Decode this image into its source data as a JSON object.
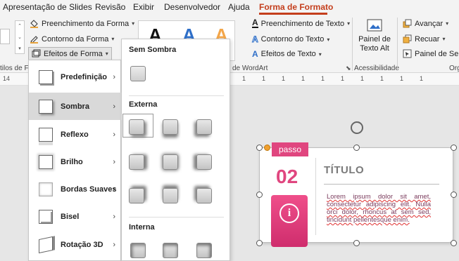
{
  "menubar": {
    "tabs": [
      {
        "label": "Apresentação de Slides"
      },
      {
        "label": "Revisão"
      },
      {
        "label": "Exibir"
      },
      {
        "label": "Desenvolvedor"
      },
      {
        "label": "Ajuda"
      },
      {
        "label": "Forma de Formato"
      }
    ]
  },
  "ribbon": {
    "fill_label": "Preenchimento da Forma",
    "outline_label": "Contorno da Forma",
    "effects_label": "Efeitos de Forma",
    "styles_group_label": "tilos de Fo",
    "wordart_group_label": "de WordArt",
    "text_fill_label": "Preenchimento de Texto",
    "text_outline_label": "Contorno do Texto",
    "text_effects_label": "Efeitos de Texto",
    "alt_text_line1": "Painel de",
    "alt_text_line2": "Texto Alt",
    "accessibility_group_label": "Acessibilidade",
    "forward_label": "Avançar",
    "backward_label": "Recuar",
    "selection_pane_label": "Painel de Sele",
    "arrange_group_label": "Org",
    "wordart_letter": "A"
  },
  "ruler": {
    "ticks": [
      "14",
      "1",
      "1",
      "1",
      "1",
      "1",
      "1",
      "1",
      "1",
      "1",
      "1"
    ]
  },
  "effects_menu": {
    "items": [
      {
        "label": "Predefinição"
      },
      {
        "label": "Sombra"
      },
      {
        "label": "Reflexo"
      },
      {
        "label": "Brilho"
      },
      {
        "label": "Bordas Suaves"
      },
      {
        "label": "Bisel"
      },
      {
        "label": "Rotação 3D"
      }
    ]
  },
  "shadow_flyout": {
    "no_shadow_header": "Sem Sombra",
    "outer_header": "Externa",
    "inner_header": "Interna"
  },
  "slide": {
    "badge": "passo",
    "number": "02",
    "title": "TÍTULO",
    "body": "Lorem ipsum dolor sit amet, consectetur adipiscing elit. Nulla orci dolor, rhoncus at sem sed, tincidunt pellentesque enim.",
    "info_symbol": "i"
  },
  "colors": {
    "accent": "#c43e1c",
    "brand_pink": "#e0467f"
  }
}
